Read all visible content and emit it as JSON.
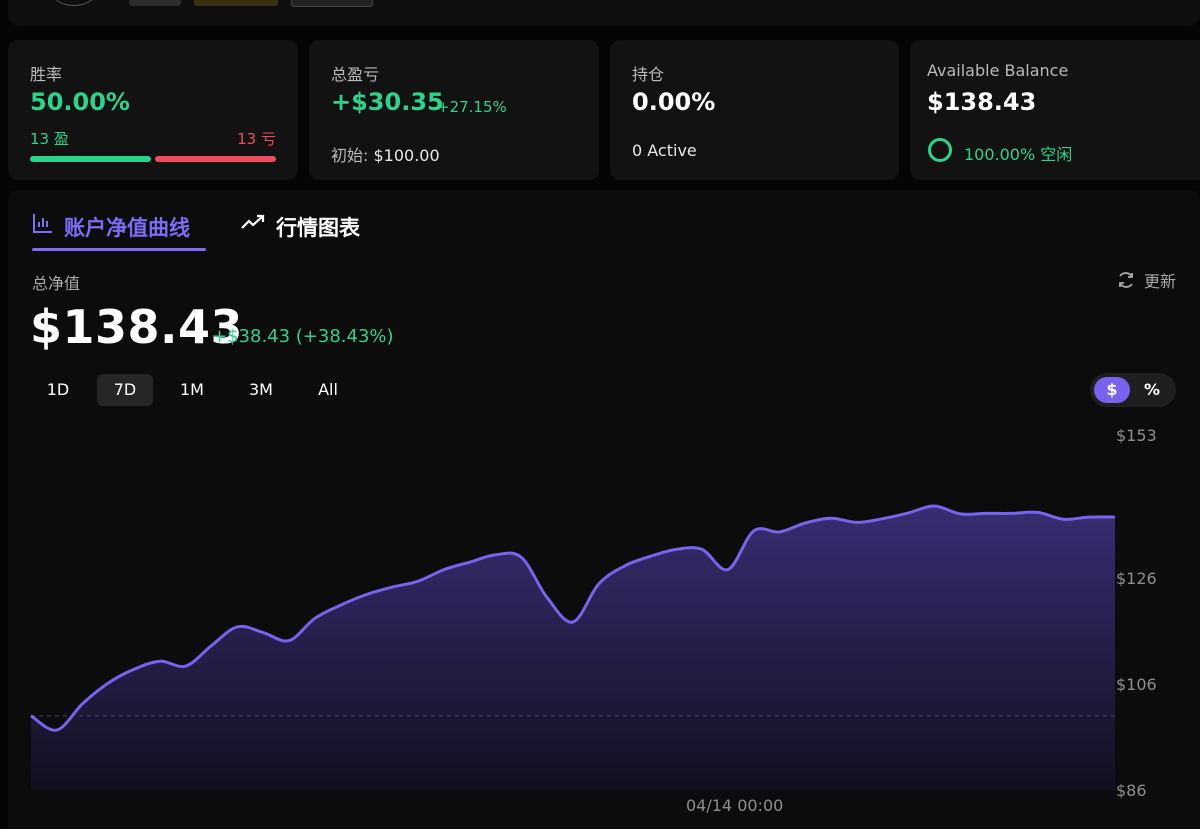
{
  "colors": {
    "positive": "#2bd48a",
    "negative": "#ef4d5e",
    "accent": "#7d6cf5"
  },
  "stats": {
    "win_rate": {
      "label": "胜率",
      "value": "50.00%",
      "wins": "13 盈",
      "losses": "13 亏",
      "win_fraction": 0.5
    },
    "total_pnl": {
      "label": "总盈亏",
      "value": "+$30.35",
      "percent": "+27.15%",
      "initial_label": "初始:",
      "initial_value": "$100.00"
    },
    "position": {
      "label": "持仓",
      "value": "0.00%",
      "active": "0 Active"
    },
    "balance": {
      "label": "Available Balance",
      "value": "$138.43",
      "idle": "100.00% 空闲"
    }
  },
  "tabs": [
    {
      "label": "账户净值曲线",
      "icon": "bar-chart-icon",
      "active": true
    },
    {
      "label": "行情图表",
      "icon": "trending-up-icon",
      "active": false
    }
  ],
  "equity": {
    "label": "总净值",
    "refresh_label": "更新",
    "value": "$138.43",
    "change": "+$38.43 (+38.43%)"
  },
  "ranges": [
    {
      "label": "1D",
      "selected": false
    },
    {
      "label": "7D",
      "selected": true
    },
    {
      "label": "1M",
      "selected": false
    },
    {
      "label": "3M",
      "selected": false
    },
    {
      "label": "All",
      "selected": false
    }
  ],
  "unit_toggle": {
    "dollar": "$",
    "percent": "%",
    "selected": "$"
  },
  "chart_data": {
    "type": "area",
    "y_tick_labels": [
      "$153",
      "$126",
      "$106",
      "$86"
    ],
    "y_ticks": [
      153,
      126,
      106,
      86
    ],
    "x_tick_labels": [
      "04/14 00:00"
    ],
    "baseline": 100,
    "y": [
      100,
      97.3,
      102.3,
      106.2,
      108.8,
      110.3,
      109.4,
      113.3,
      116.8,
      115.7,
      114.2,
      118.4,
      120.9,
      122.9,
      124.3,
      125.4,
      127.6,
      129,
      130.4,
      129.9,
      122.3,
      117.7,
      124.9,
      128.3,
      130.1,
      131.4,
      131.4,
      127.6,
      134.9,
      134.7,
      136.4,
      137.3,
      136.5,
      137.2,
      138.3,
      139.6,
      138.1,
      138.2,
      138.2,
      138.4,
      137.1,
      137.5,
      137.5
    ]
  }
}
